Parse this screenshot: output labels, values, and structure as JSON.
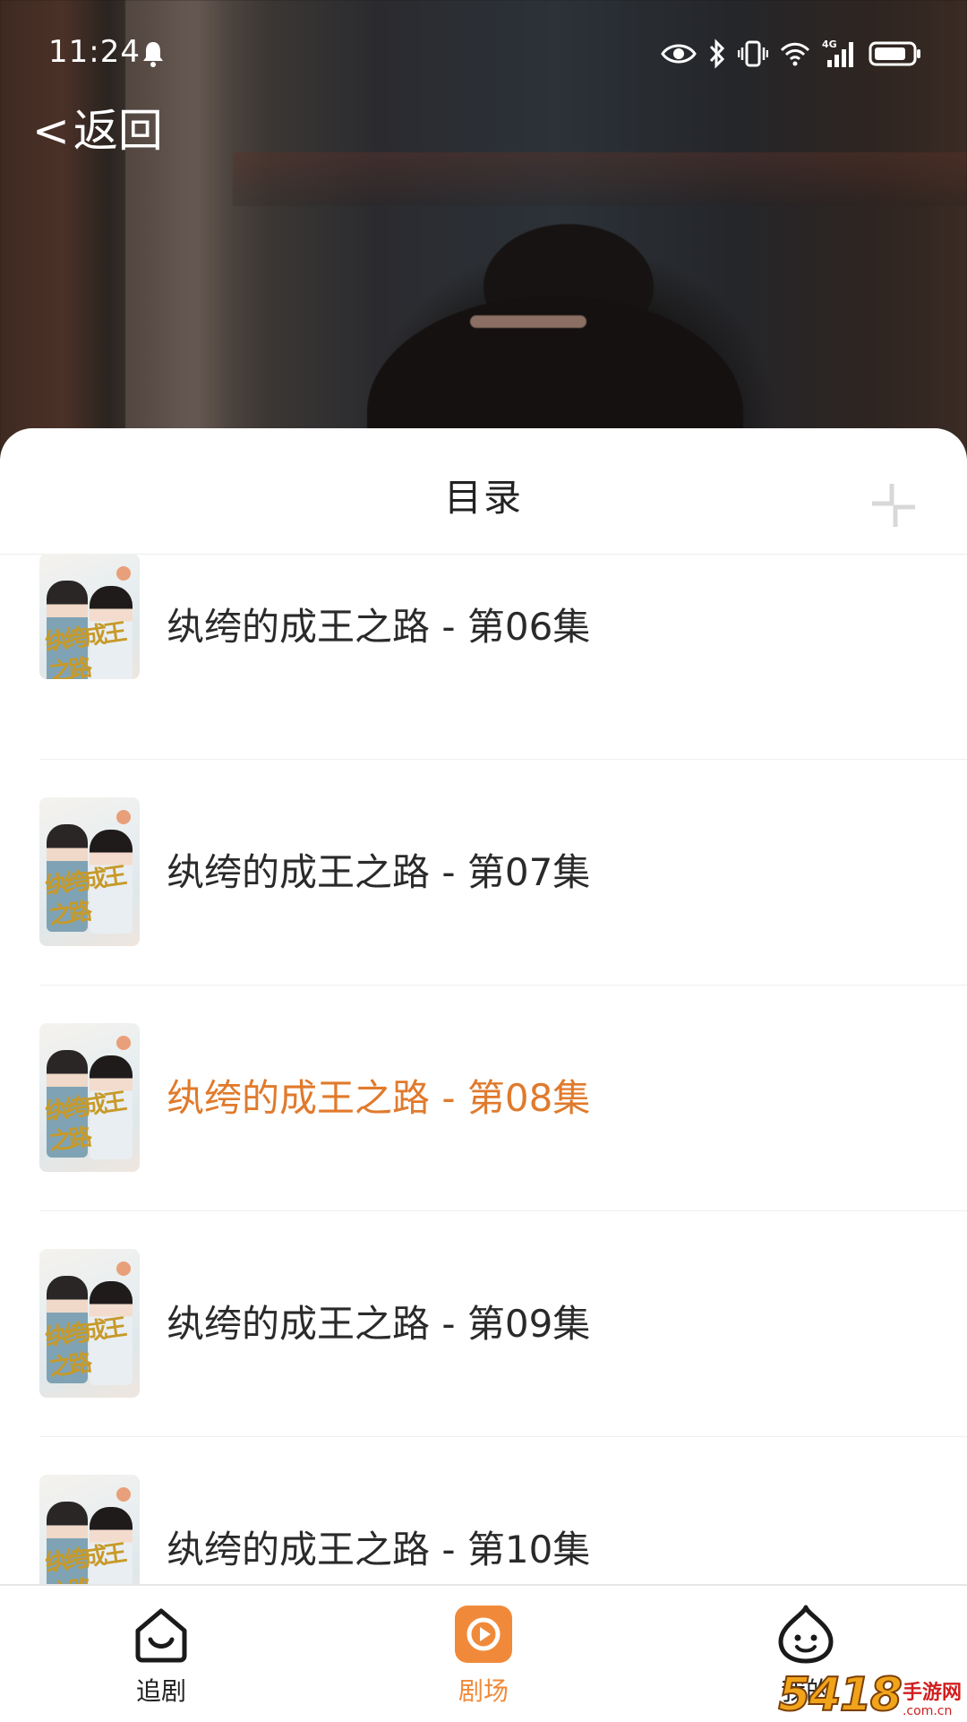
{
  "status_bar": {
    "time": "11:24",
    "icons": [
      "bell-icon",
      "eye-icon",
      "bluetooth-icon",
      "vibrate-icon",
      "wifi-icon",
      "signal-4g-icon",
      "battery-icon"
    ],
    "network": "4G"
  },
  "header": {
    "back_chevron": "<",
    "back_label": "返回"
  },
  "sheet": {
    "title": "目录",
    "collapse_icon": "collapse-icon"
  },
  "episodes": [
    {
      "label": "纨绔的成王之路 - 第06集",
      "active": false
    },
    {
      "label": "纨绔的成王之路 - 第07集",
      "active": false
    },
    {
      "label": "纨绔的成王之路 - 第08集",
      "active": true
    },
    {
      "label": "纨绔的成王之路 - 第09集",
      "active": false
    },
    {
      "label": "纨绔的成王之路 - 第10集",
      "active": false
    }
  ],
  "thumbnail_calligraphy": "纨绔成王之路",
  "bottom_nav": {
    "items": [
      {
        "label": "追剧",
        "icon": "home-smile-icon",
        "active": false
      },
      {
        "label": "剧场",
        "icon": "play-icon",
        "active": true
      },
      {
        "label": "我的",
        "icon": "profile-face-icon",
        "active": false
      }
    ]
  },
  "watermark": {
    "number": "5418",
    "text": "手游网",
    "domain": ".com.cn"
  },
  "colors": {
    "accent": "#e07a2c",
    "nav_active": "#f08a3a",
    "text": "#2a2a2a"
  }
}
